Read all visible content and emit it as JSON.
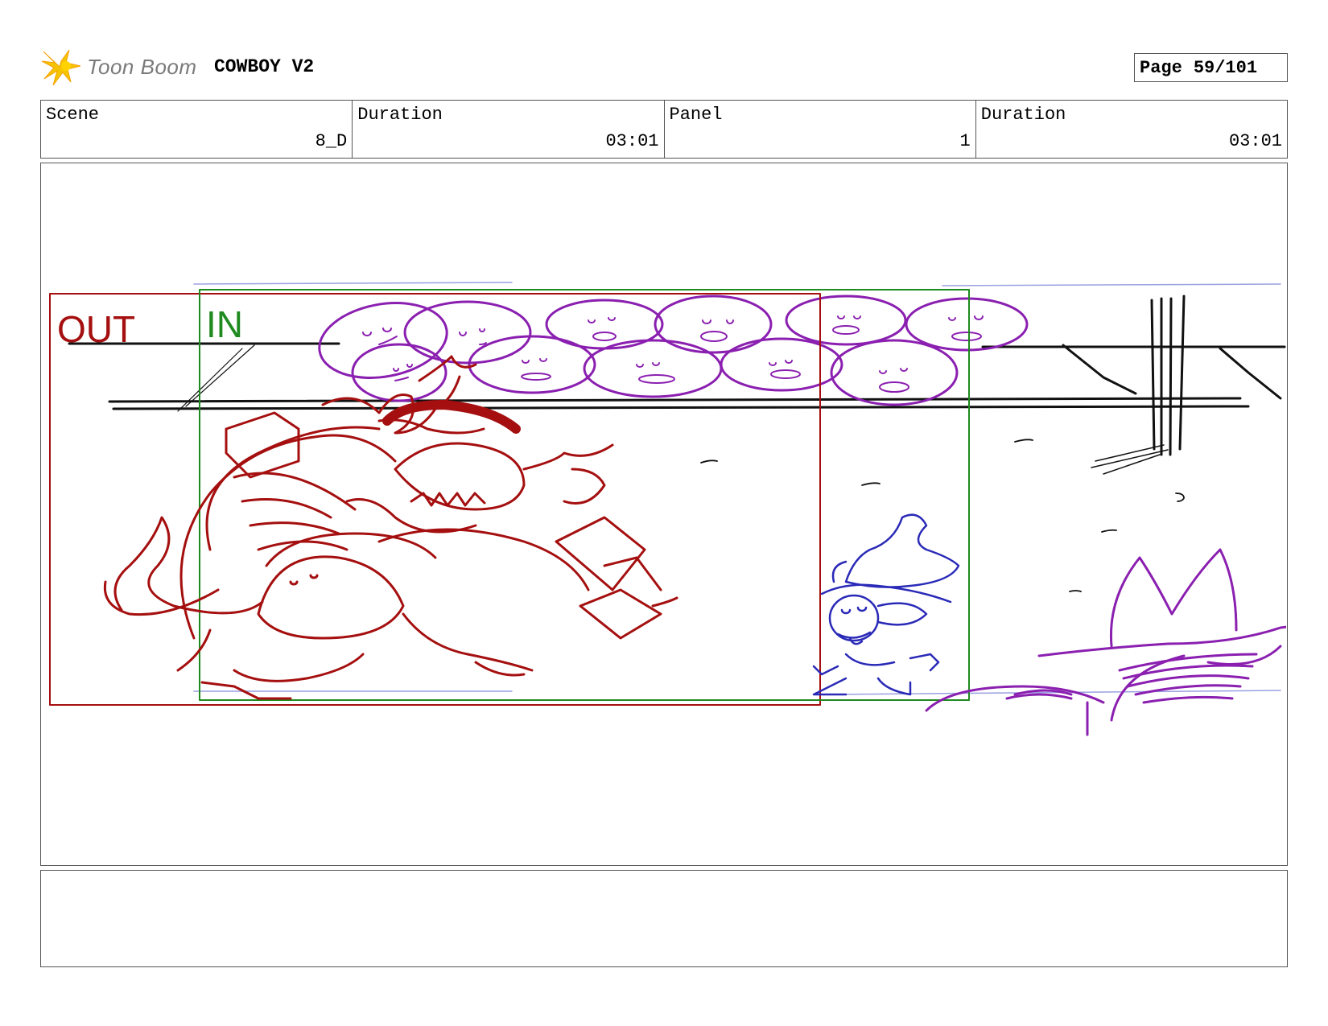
{
  "header": {
    "logo_text": "Toon Boom",
    "project_title": "COWBOY V2",
    "page_label": "Page",
    "page_number": "59/101"
  },
  "info": {
    "scene_label": "Scene",
    "scene_value": "8_D",
    "scene_duration_label": "Duration",
    "scene_duration_value": "03:01",
    "panel_label": "Panel",
    "panel_value": "1",
    "panel_duration_label": "Duration",
    "panel_duration_value": "03:01"
  },
  "panel_frame": {
    "out_label": "OUT",
    "in_label": "IN",
    "out_color": "#a50f0f",
    "in_color": "#1f8a1f",
    "crowd_color": "#8a1fb0",
    "hero_color": "#2a2ab8",
    "background_color": "#111111"
  },
  "notes": {
    "text": ""
  }
}
